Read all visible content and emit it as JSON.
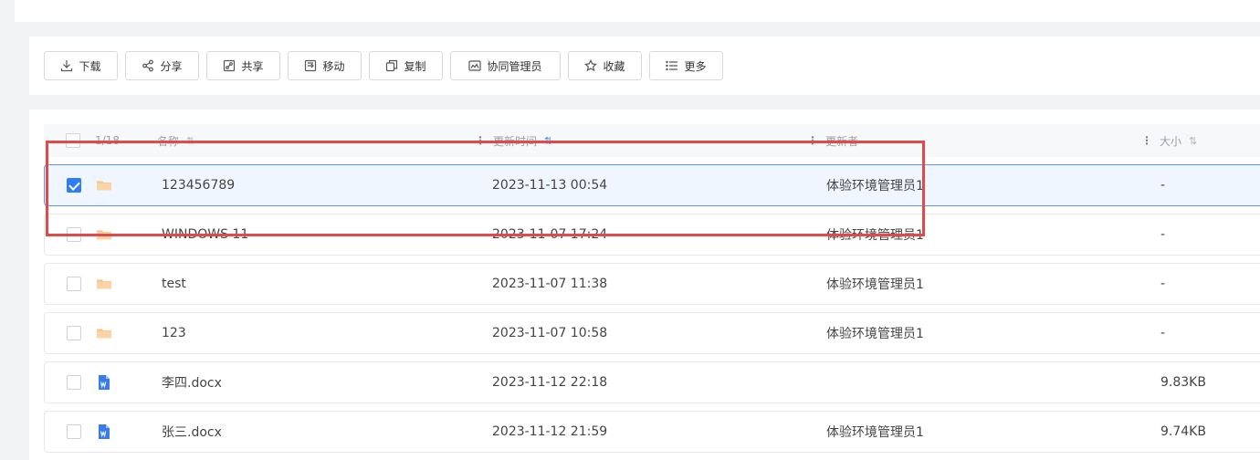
{
  "toolbar": {
    "buttons": [
      {
        "label": "下载",
        "icon": "download-icon"
      },
      {
        "label": "分享",
        "icon": "share-icon"
      },
      {
        "label": "共享",
        "icon": "co-share-icon"
      },
      {
        "label": "移动",
        "icon": "move-icon"
      },
      {
        "label": "复制",
        "icon": "copy-icon"
      },
      {
        "label": "协同管理员",
        "icon": "collab-admin-icon"
      },
      {
        "label": "收藏",
        "icon": "star-icon"
      },
      {
        "label": "更多",
        "icon": "list-icon"
      }
    ]
  },
  "table": {
    "selection_count": "1/18",
    "columns": {
      "name": "名称",
      "time": "更新时间",
      "user": "更新者",
      "size": "大小"
    },
    "rows": [
      {
        "name": "123456789",
        "time": "2023-11-13 00:54",
        "user": "体验环境管理员1",
        "size": "-",
        "type": "folder",
        "checked": true
      },
      {
        "name": "WINDOWS 11",
        "time": "2023-11-07 17:24",
        "user": "体验环境管理员1",
        "size": "-",
        "type": "folder",
        "checked": false
      },
      {
        "name": "test",
        "time": "2023-11-07 11:38",
        "user": "体验环境管理员1",
        "size": "-",
        "type": "folder",
        "checked": false
      },
      {
        "name": "123",
        "time": "2023-11-07 10:58",
        "user": "体验环境管理员1",
        "size": "-",
        "type": "folder",
        "checked": false
      },
      {
        "name": "李四.docx",
        "time": "2023-11-12 22:18",
        "user": "",
        "size": "9.83KB",
        "type": "word",
        "checked": false
      },
      {
        "name": "张三.docx",
        "time": "2023-11-12 21:59",
        "user": "体验环境管理员1",
        "size": "9.74KB",
        "type": "word",
        "checked": false
      }
    ]
  },
  "colors": {
    "accent": "#2e7cf6",
    "highlight": "#e24a4a",
    "folder": "#f7c18c",
    "word": "#3a7bea"
  }
}
